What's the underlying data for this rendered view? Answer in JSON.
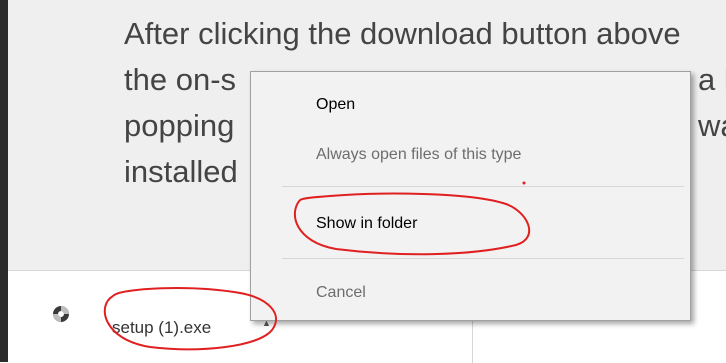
{
  "article": {
    "lines": [
      "After clicking the download button above",
      "the on-s",
      "popping",
      "installed"
    ],
    "right_fragments": [
      "a l",
      "wa"
    ]
  },
  "download_bar": {
    "file_name": "setup (1).exe",
    "icon": "setup-disc-icon",
    "chevron": "chevron-up-icon"
  },
  "context_menu": {
    "items": [
      {
        "label": "Open",
        "enabled": true
      },
      {
        "label": "Always open files of this type",
        "enabled": false
      },
      {
        "label": "Show in folder",
        "enabled": true
      },
      {
        "label": "Cancel",
        "enabled": false
      }
    ]
  },
  "colors": {
    "annotation": "#e02020",
    "article_bg": "#efefef",
    "menu_bg": "#f2f2f2"
  }
}
